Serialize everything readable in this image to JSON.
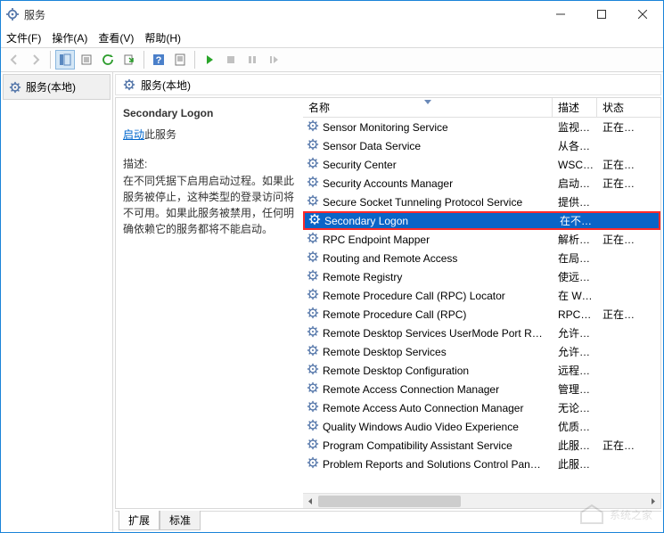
{
  "window": {
    "title": "服务"
  },
  "menu": {
    "file": "文件(F)",
    "action": "操作(A)",
    "view": "查看(V)",
    "help": "帮助(H)"
  },
  "tree": {
    "root": "服务(本地)"
  },
  "header": {
    "title": "服务(本地)"
  },
  "detail": {
    "name": "Secondary Logon",
    "start_link": "启动",
    "start_suffix": "此服务",
    "desc_label": "描述:",
    "desc_text": "在不同凭据下启用启动过程。如果此服务被停止，这种类型的登录访问将不可用。如果此服务被禁用，任何明确依赖它的服务都将不能启动。"
  },
  "columns": {
    "name": "名称",
    "desc": "描述",
    "state": "状态"
  },
  "services": [
    {
      "name": "Sensor Monitoring Service",
      "desc": "监视…",
      "state": "正在…"
    },
    {
      "name": "Sensor Data Service",
      "desc": "从各…",
      "state": ""
    },
    {
      "name": "Security Center",
      "desc": "WSC…",
      "state": "正在…"
    },
    {
      "name": "Security Accounts Manager",
      "desc": "启动…",
      "state": "正在…"
    },
    {
      "name": "Secure Socket Tunneling Protocol Service",
      "desc": "提供…",
      "state": ""
    },
    {
      "name": "Secondary Logon",
      "desc": "在不…",
      "state": "",
      "selected": true
    },
    {
      "name": "RPC Endpoint Mapper",
      "desc": "解析…",
      "state": "正在…"
    },
    {
      "name": "Routing and Remote Access",
      "desc": "在局…",
      "state": ""
    },
    {
      "name": "Remote Registry",
      "desc": "使远…",
      "state": ""
    },
    {
      "name": "Remote Procedure Call (RPC) Locator",
      "desc": "在 W…",
      "state": ""
    },
    {
      "name": "Remote Procedure Call (RPC)",
      "desc": "RPC…",
      "state": "正在…"
    },
    {
      "name": "Remote Desktop Services UserMode Port R…",
      "desc": "允许…",
      "state": ""
    },
    {
      "name": "Remote Desktop Services",
      "desc": "允许…",
      "state": ""
    },
    {
      "name": "Remote Desktop Configuration",
      "desc": "远程…",
      "state": ""
    },
    {
      "name": "Remote Access Connection Manager",
      "desc": "管理…",
      "state": ""
    },
    {
      "name": "Remote Access Auto Connection Manager",
      "desc": "无论…",
      "state": ""
    },
    {
      "name": "Quality Windows Audio Video Experience",
      "desc": "优质…",
      "state": ""
    },
    {
      "name": "Program Compatibility Assistant Service",
      "desc": "此服…",
      "state": "正在…"
    },
    {
      "name": "Problem Reports and Solutions Control Pan…",
      "desc": "此服…",
      "state": ""
    }
  ],
  "tabs": {
    "extended": "扩展",
    "standard": "标准"
  },
  "watermark": "系统之家"
}
